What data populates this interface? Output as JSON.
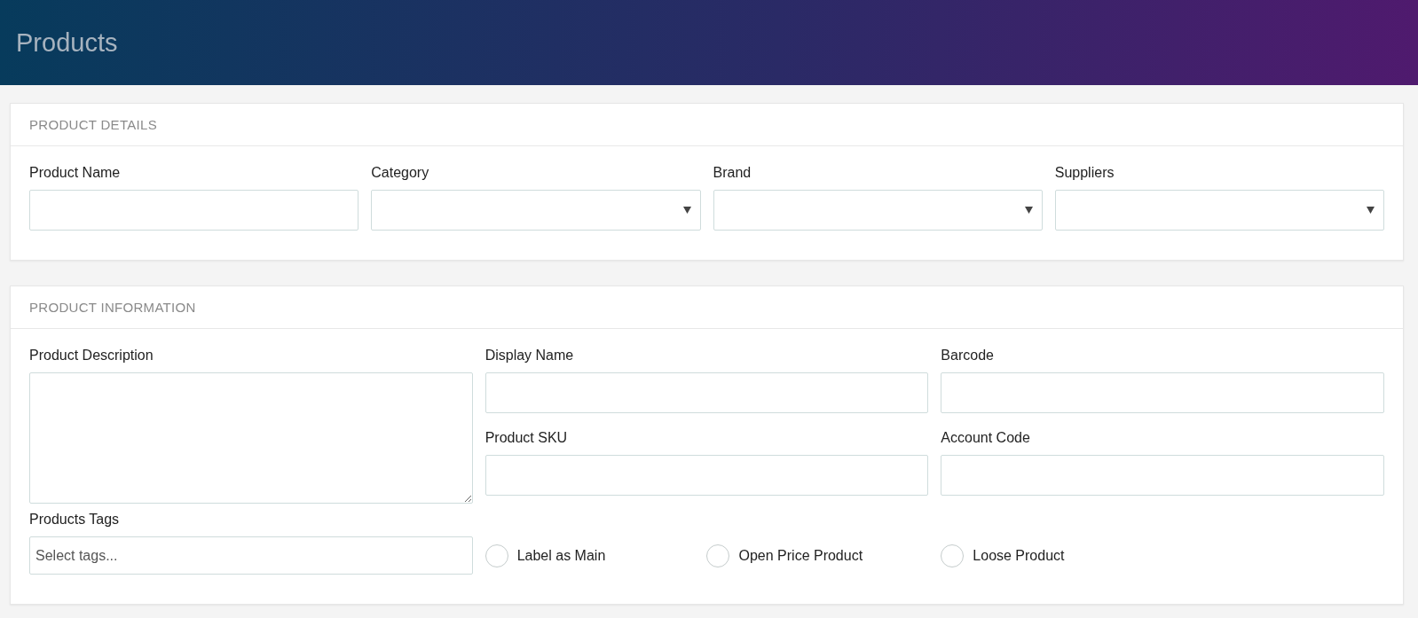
{
  "header": {
    "title": "Products"
  },
  "product_details": {
    "title": "PRODUCT DETAILS",
    "fields": [
      {
        "label": "Product Name",
        "kind": "text"
      },
      {
        "label": "Category",
        "kind": "select"
      },
      {
        "label": "Brand",
        "kind": "select"
      },
      {
        "label": "Suppliers",
        "kind": "select"
      }
    ]
  },
  "product_information": {
    "title": "PRODUCT INFORMATION",
    "description": {
      "label": "Product Description"
    },
    "fields": [
      {
        "label": "Display Name"
      },
      {
        "label": "Barcode"
      },
      {
        "label": "Product SKU"
      },
      {
        "label": "Account Code"
      }
    ],
    "tags": {
      "label": "Products Tags",
      "placeholder": "Select tags..."
    },
    "options": [
      {
        "label": "Label as Main",
        "checked": false
      },
      {
        "label": "Open Price Product",
        "checked": false
      },
      {
        "label": "Loose Product",
        "checked": false
      }
    ]
  }
}
